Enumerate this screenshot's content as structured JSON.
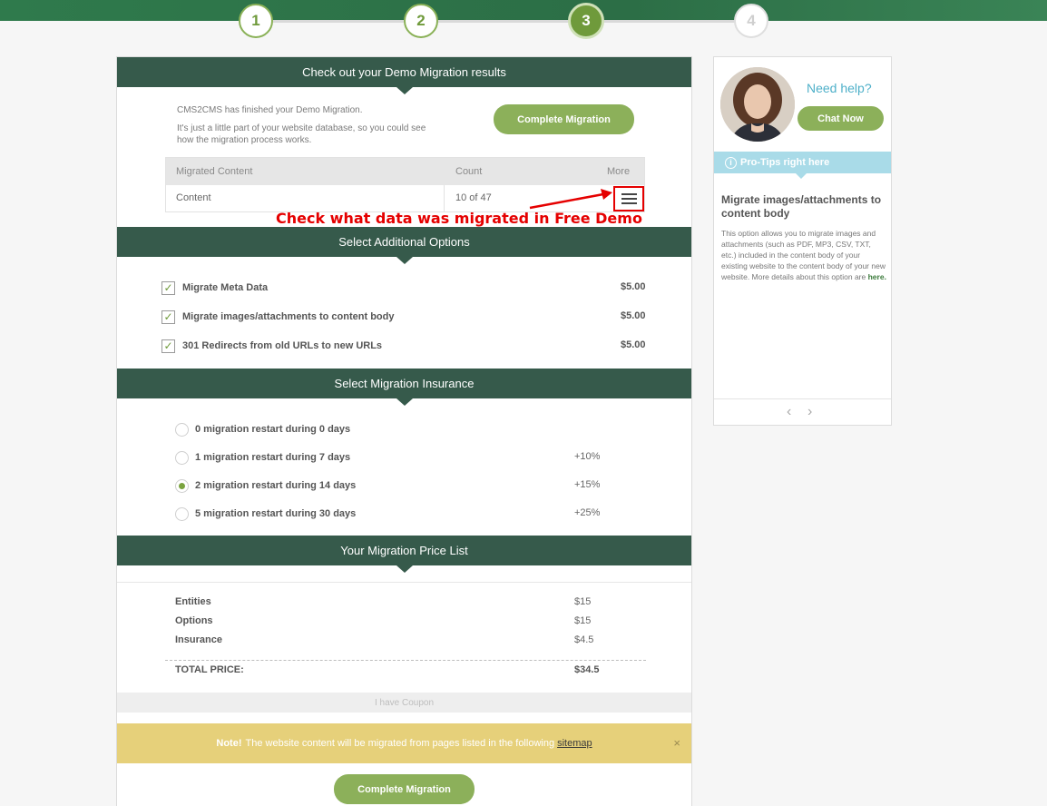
{
  "stepper": {
    "steps": [
      "1",
      "2",
      "3",
      "4"
    ],
    "active_index": 3
  },
  "demo": {
    "title": "Check out your Demo Migration results",
    "finished_text": "CMS2CMS has finished your Demo Migration.",
    "explain_line1": "It's just a little part of your website database, so you could see",
    "explain_line2": "how the migration process works.",
    "complete_button": "Complete Migration",
    "table": {
      "headers": {
        "content": "Migrated Content",
        "count": "Count",
        "more": "More"
      },
      "row": {
        "content": "Content",
        "count": "10 of 47"
      }
    },
    "annotation": "Check what data was migrated in Free Demo"
  },
  "options": {
    "title": "Select Additional Options",
    "items": [
      {
        "label": "Migrate Meta Data",
        "price": "$5.00"
      },
      {
        "label": "Migrate images/attachments to content body",
        "price": "$5.00"
      },
      {
        "label": "301 Redirects from old URLs to new URLs",
        "price": "$5.00"
      }
    ]
  },
  "insurance": {
    "title": "Select Migration Insurance",
    "items": [
      {
        "label": "0 migration restart during 0 days",
        "pct": ""
      },
      {
        "label": "1 migration restart during 7 days",
        "pct": "+10%"
      },
      {
        "label": "2 migration restart during 14 days",
        "pct": "+15%"
      },
      {
        "label": "5 migration restart during 30 days",
        "pct": "+25%"
      }
    ],
    "selected_index": 2
  },
  "price_list": {
    "title": "Your Migration Price List",
    "rows": [
      {
        "label": "Entities",
        "value": "$15"
      },
      {
        "label": "Options",
        "value": "$15"
      },
      {
        "label": "Insurance",
        "value": "$4.5"
      }
    ],
    "total_label": "TOTAL PRICE:",
    "total_value": "$34.5",
    "coupon": "I have Coupon"
  },
  "note": {
    "bold": "Note!",
    "text": "The website content will be migrated from pages listed in the following",
    "link": "sitemap",
    "close": "×"
  },
  "complete_button_bottom": "Complete Migration",
  "help": {
    "need_help": "Need help?",
    "chat_button": "Chat Now",
    "tips_bar": "Pro-Tips right here",
    "tip_title": "Migrate images/attachments to content body",
    "tip_body": "This option allows you to migrate images and attachments (such as PDF, MP3, CSV, TXT, etc.) included in the content body of your existing website to the content body of your new website. More details about this option are",
    "tip_link": "here."
  }
}
